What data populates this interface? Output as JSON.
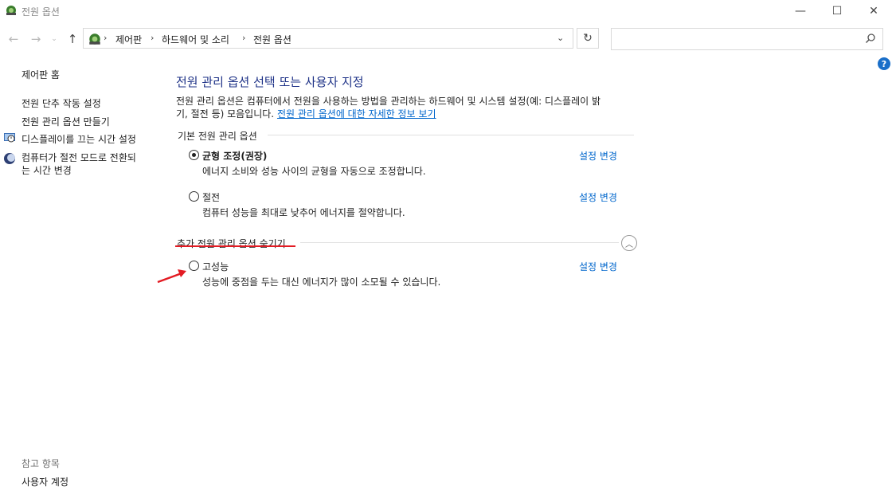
{
  "window": {
    "title": "전원 옵션",
    "min_glyph": "—",
    "max_glyph": "☐",
    "close_glyph": "✕"
  },
  "nav": {
    "back_glyph": "←",
    "forward_glyph": "→",
    "recent_glyph": "⌄",
    "up_glyph": "↑",
    "breadcrumb": [
      "제어판",
      "하드웨어 및 소리",
      "전원 옵션"
    ],
    "separator": "›",
    "dropdown_glyph": "⌄",
    "refresh_glyph": "↻",
    "search_placeholder": "",
    "search_icon": "search-icon"
  },
  "help": {
    "glyph": "?"
  },
  "sidebar": {
    "home": "제어판 홈",
    "links": [
      "전원 단추 작동 설정",
      "전원 관리 옵션 만들기",
      "디스플레이를 끄는 시간 설정",
      "컴퓨터가 절전 모드로 전환되는 시간 변경"
    ],
    "sleep_line1": "컴퓨터가 절전 모드로 전환되",
    "sleep_line2": "는 시간 변경",
    "see_also": "참고 항목",
    "see_also_links": [
      "사용자 계정"
    ]
  },
  "main": {
    "heading": "전원 관리 옵션 선택 또는 사용자 지정",
    "intro_line1": "전원 관리 옵션은 컴퓨터에서 전원을 사용하는 방법을 관리하는 하드웨어 및 시스템 설정(예: 디스플레이 밝",
    "intro_line2": "기, 절전 등) 모음입니다.",
    "intro_link": "전원 관리 옵션에 대한 자세한 정보 보기",
    "basic_group_title": "기본 전원 관리 옵션",
    "extra_group_title": "추가 전원 관리 옵션 숨기기",
    "collapse_glyph": "︿",
    "plans": [
      {
        "name": "균형 조정(권장)",
        "desc": "에너지 소비와 성능 사이의 균형을 자동으로 조정합니다.",
        "link": "설정 변경",
        "selected": true
      },
      {
        "name": "절전",
        "desc": "컴퓨터 성능을 최대로 낮추어 에너지를 절약합니다.",
        "link": "설정 변경",
        "selected": false
      },
      {
        "name": "고성능",
        "desc": "성능에 중점을 두는 대신 에너지가 많이 소모될 수 있습니다.",
        "link": "설정 변경",
        "selected": false
      }
    ]
  },
  "colors": {
    "heading": "#1e3287",
    "link": "#0066cc",
    "annotation_red": "#e31b23"
  }
}
